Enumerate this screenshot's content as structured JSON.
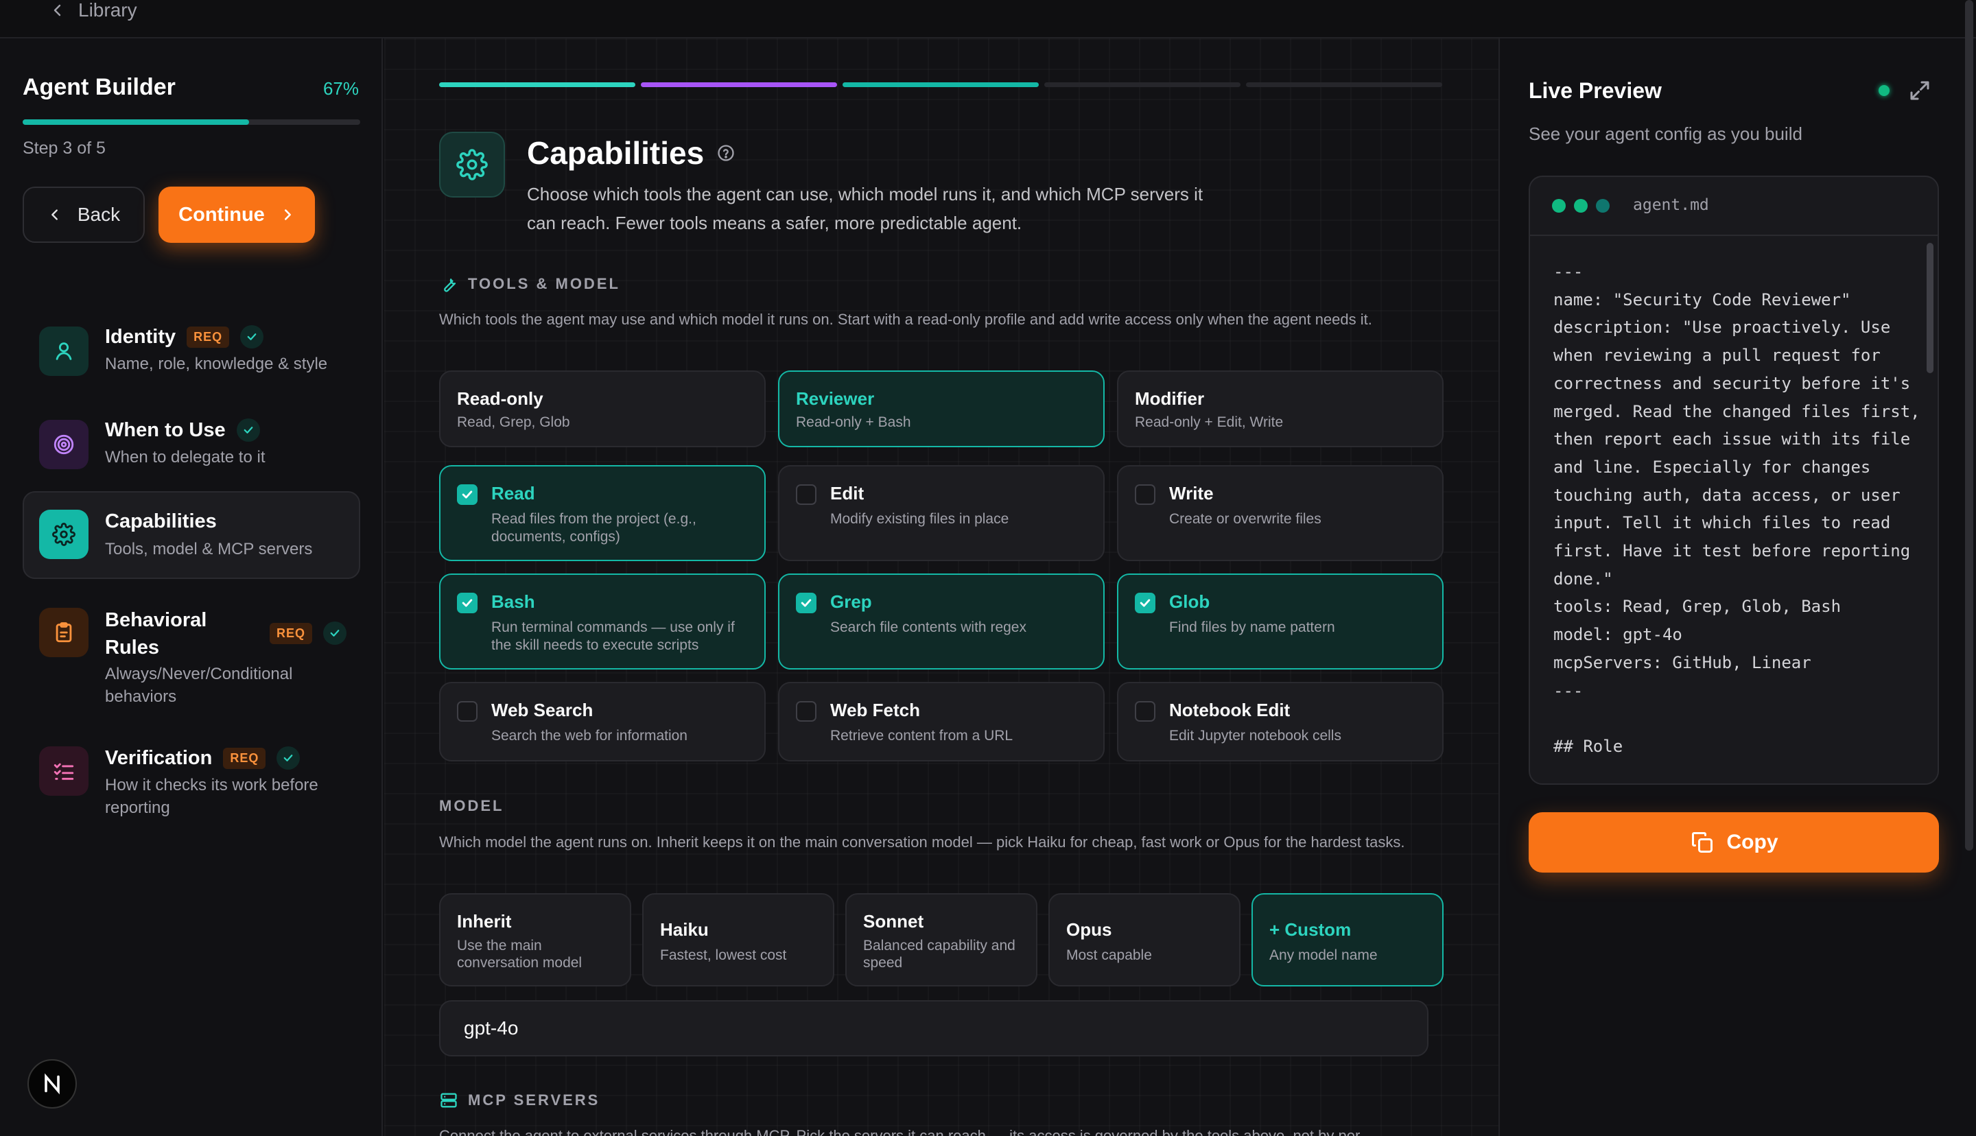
{
  "topbar": {
    "back_label": "Library"
  },
  "sidebar": {
    "title": "Agent Builder",
    "progress_pct": "67%",
    "progress": 0.67,
    "step_label": "Step 3 of 5",
    "back_label": "Back",
    "continue_label": "Continue",
    "items": [
      {
        "title": "Identity",
        "badge": "REQ",
        "subtitle": "Name, role, knowledge & style",
        "icon": "user-icon"
      },
      {
        "title": "When to Use",
        "subtitle": "When to delegate to it",
        "icon": "target-icon"
      },
      {
        "title": "Capabilities",
        "subtitle": "Tools, model & MCP servers",
        "icon": "gear-icon"
      },
      {
        "title": "Behavioral Rules",
        "badge": "REQ",
        "subtitle": "Always/Never/Conditional behaviors",
        "icon": "clipboard-icon"
      },
      {
        "title": "Verification",
        "badge": "REQ",
        "subtitle": "How it checks its work before reporting",
        "icon": "checklist-icon"
      }
    ]
  },
  "main": {
    "title": "Capabilities",
    "description": "Choose which tools the agent can use, which model runs it, and which MCP servers it can reach. Fewer tools means a safer, more predictable agent.",
    "tools_section": {
      "label": "TOOLS & MODEL",
      "description": "Which tools the agent may use and which model it runs on. Start with a read-only profile and add write access only when the agent needs it."
    },
    "profiles": [
      {
        "title": "Read-only",
        "subtitle": "Read, Grep, Glob",
        "selected": false
      },
      {
        "title": "Reviewer",
        "subtitle": "Read-only + Bash",
        "selected": true
      },
      {
        "title": "Modifier",
        "subtitle": "Read-only + Edit, Write",
        "selected": false
      }
    ],
    "tools": [
      {
        "title": "Read",
        "subtitle": "Read files from the project (e.g., documents, configs)",
        "checked": true
      },
      {
        "title": "Edit",
        "subtitle": "Modify existing files in place",
        "checked": false
      },
      {
        "title": "Write",
        "subtitle": "Create or overwrite files",
        "checked": false
      },
      {
        "title": "Bash",
        "subtitle": "Run terminal commands — use only if the skill needs to execute scripts",
        "checked": true
      },
      {
        "title": "Grep",
        "subtitle": "Search file contents with regex",
        "checked": true
      },
      {
        "title": "Glob",
        "subtitle": "Find files by name pattern",
        "checked": true
      },
      {
        "title": "Web Search",
        "subtitle": "Search the web for information",
        "checked": false
      },
      {
        "title": "Web Fetch",
        "subtitle": "Retrieve content from a URL",
        "checked": false
      },
      {
        "title": "Notebook Edit",
        "subtitle": "Edit Jupyter notebook cells",
        "checked": false
      }
    ],
    "model_section": {
      "label": "MODEL",
      "description": "Which model the agent runs on. Inherit keeps it on the main conversation model — pick Haiku for cheap, fast work or Opus for the hardest tasks."
    },
    "models": [
      {
        "title": "Inherit",
        "subtitle": "Use the main conversation model"
      },
      {
        "title": "Haiku",
        "subtitle": "Fastest, lowest cost"
      },
      {
        "title": "Sonnet",
        "subtitle": "Balanced capability and speed"
      },
      {
        "title": "Opus",
        "subtitle": "Most capable"
      },
      {
        "title": "+ Custom",
        "subtitle": "Any model name"
      }
    ],
    "model_value": "gpt-4o",
    "mcp_section": {
      "label": "MCP SERVERS",
      "description": "Connect the agent to external services through MCP. Pick the servers it can reach — its access is governed by the tools above, not by per"
    }
  },
  "preview": {
    "title": "Live Preview",
    "subtitle": "See your agent config as you build",
    "file_name": "agent.md",
    "code": "---\nname: \"Security Code Reviewer\"\ndescription: \"Use proactively. Use when reviewing a pull request for correctness and security before it's merged. Read the changed files first, then report each issue with its file and line. Especially for changes touching auth, data access, or user input. Tell it which files to read first. Have it test before reporting done.\"\ntools: Read, Grep, Glob, Bash\nmodel: gpt-4o\nmcpServers: GitHub, Linear\n---\n\n## Role",
    "copy_label": "Copy"
  },
  "colors": {
    "accent": "#14b8a6",
    "brand": "#f97316",
    "purple": "#a855f7"
  }
}
